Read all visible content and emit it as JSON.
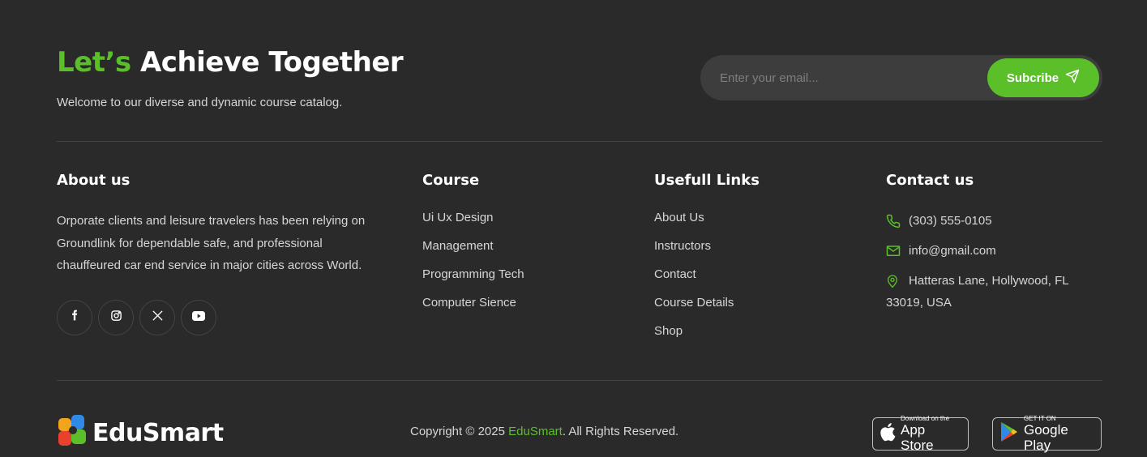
{
  "hero": {
    "title_accent": "Let’s",
    "title_rest": " Achieve Together",
    "subtitle": "Welcome to our diverse and dynamic course catalog."
  },
  "subscribe": {
    "placeholder": "Enter your email...",
    "button_label": "Subcribe"
  },
  "about": {
    "heading": "About us",
    "text": "Orporate clients and leisure travelers has been relying on Groundlink for dependable safe, and professional chauffeured car end service in major cities across World.",
    "socials": [
      "facebook-icon",
      "instagram-icon",
      "x-icon",
      "youtube-icon"
    ]
  },
  "course": {
    "heading": "Course",
    "links": [
      "Ui Ux Design",
      "Management",
      "Programming Tech",
      "Computer Sience"
    ]
  },
  "useful": {
    "heading": "Usefull Links",
    "links": [
      "About Us",
      "Instructors",
      "Contact",
      "Course Details",
      "Shop"
    ]
  },
  "contact": {
    "heading": "Contact us",
    "phone": "(303) 555-0105",
    "email": "info@gmail.com",
    "address": "Hatteras Lane, Hollywood, FL 33019, USA"
  },
  "footer": {
    "logo_text": "EduSmart",
    "copyright_prefix": "Copyright © 2025 ",
    "copyright_brand": "EduSmart",
    "copyright_suffix": ". All Rights Reserved.",
    "app_store_small": "Download on the",
    "app_store_big": "App Store",
    "google_play_small": "GET IT ON",
    "google_play_big": "Google Play"
  },
  "colors": {
    "background": "#2a2a2a",
    "accent": "#5bbf2a",
    "input_bg": "#3d3d3d",
    "divider": "#444444"
  }
}
